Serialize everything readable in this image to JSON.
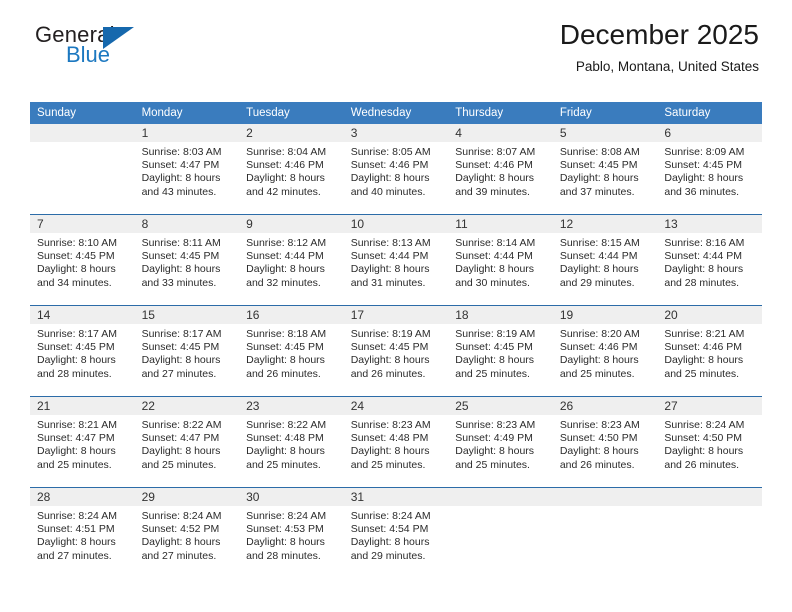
{
  "brand": {
    "name_part1": "General",
    "name_part2": "Blue",
    "flag_icon": "flag-triangle-icon",
    "accent_color": "#1668ad"
  },
  "header": {
    "title": "December 2025",
    "subtitle": "Pablo, Montana, United States"
  },
  "theme": {
    "header_bg": "#3a7cbe",
    "daynum_bg": "#efefef",
    "row_divider": "#2c6ca8"
  },
  "weekdays": [
    "Sunday",
    "Monday",
    "Tuesday",
    "Wednesday",
    "Thursday",
    "Friday",
    "Saturday"
  ],
  "weeks": [
    [
      {
        "day": ""
      },
      {
        "day": "1",
        "sunrise": "Sunrise: 8:03 AM",
        "sunset": "Sunset: 4:47 PM",
        "daylight_line1": "Daylight: 8 hours",
        "daylight_line2": "and 43 minutes."
      },
      {
        "day": "2",
        "sunrise": "Sunrise: 8:04 AM",
        "sunset": "Sunset: 4:46 PM",
        "daylight_line1": "Daylight: 8 hours",
        "daylight_line2": "and 42 minutes."
      },
      {
        "day": "3",
        "sunrise": "Sunrise: 8:05 AM",
        "sunset": "Sunset: 4:46 PM",
        "daylight_line1": "Daylight: 8 hours",
        "daylight_line2": "and 40 minutes."
      },
      {
        "day": "4",
        "sunrise": "Sunrise: 8:07 AM",
        "sunset": "Sunset: 4:46 PM",
        "daylight_line1": "Daylight: 8 hours",
        "daylight_line2": "and 39 minutes."
      },
      {
        "day": "5",
        "sunrise": "Sunrise: 8:08 AM",
        "sunset": "Sunset: 4:45 PM",
        "daylight_line1": "Daylight: 8 hours",
        "daylight_line2": "and 37 minutes."
      },
      {
        "day": "6",
        "sunrise": "Sunrise: 8:09 AM",
        "sunset": "Sunset: 4:45 PM",
        "daylight_line1": "Daylight: 8 hours",
        "daylight_line2": "and 36 minutes."
      }
    ],
    [
      {
        "day": "7",
        "sunrise": "Sunrise: 8:10 AM",
        "sunset": "Sunset: 4:45 PM",
        "daylight_line1": "Daylight: 8 hours",
        "daylight_line2": "and 34 minutes."
      },
      {
        "day": "8",
        "sunrise": "Sunrise: 8:11 AM",
        "sunset": "Sunset: 4:45 PM",
        "daylight_line1": "Daylight: 8 hours",
        "daylight_line2": "and 33 minutes."
      },
      {
        "day": "9",
        "sunrise": "Sunrise: 8:12 AM",
        "sunset": "Sunset: 4:44 PM",
        "daylight_line1": "Daylight: 8 hours",
        "daylight_line2": "and 32 minutes."
      },
      {
        "day": "10",
        "sunrise": "Sunrise: 8:13 AM",
        "sunset": "Sunset: 4:44 PM",
        "daylight_line1": "Daylight: 8 hours",
        "daylight_line2": "and 31 minutes."
      },
      {
        "day": "11",
        "sunrise": "Sunrise: 8:14 AM",
        "sunset": "Sunset: 4:44 PM",
        "daylight_line1": "Daylight: 8 hours",
        "daylight_line2": "and 30 minutes."
      },
      {
        "day": "12",
        "sunrise": "Sunrise: 8:15 AM",
        "sunset": "Sunset: 4:44 PM",
        "daylight_line1": "Daylight: 8 hours",
        "daylight_line2": "and 29 minutes."
      },
      {
        "day": "13",
        "sunrise": "Sunrise: 8:16 AM",
        "sunset": "Sunset: 4:44 PM",
        "daylight_line1": "Daylight: 8 hours",
        "daylight_line2": "and 28 minutes."
      }
    ],
    [
      {
        "day": "14",
        "sunrise": "Sunrise: 8:17 AM",
        "sunset": "Sunset: 4:45 PM",
        "daylight_line1": "Daylight: 8 hours",
        "daylight_line2": "and 28 minutes."
      },
      {
        "day": "15",
        "sunrise": "Sunrise: 8:17 AM",
        "sunset": "Sunset: 4:45 PM",
        "daylight_line1": "Daylight: 8 hours",
        "daylight_line2": "and 27 minutes."
      },
      {
        "day": "16",
        "sunrise": "Sunrise: 8:18 AM",
        "sunset": "Sunset: 4:45 PM",
        "daylight_line1": "Daylight: 8 hours",
        "daylight_line2": "and 26 minutes."
      },
      {
        "day": "17",
        "sunrise": "Sunrise: 8:19 AM",
        "sunset": "Sunset: 4:45 PM",
        "daylight_line1": "Daylight: 8 hours",
        "daylight_line2": "and 26 minutes."
      },
      {
        "day": "18",
        "sunrise": "Sunrise: 8:19 AM",
        "sunset": "Sunset: 4:45 PM",
        "daylight_line1": "Daylight: 8 hours",
        "daylight_line2": "and 25 minutes."
      },
      {
        "day": "19",
        "sunrise": "Sunrise: 8:20 AM",
        "sunset": "Sunset: 4:46 PM",
        "daylight_line1": "Daylight: 8 hours",
        "daylight_line2": "and 25 minutes."
      },
      {
        "day": "20",
        "sunrise": "Sunrise: 8:21 AM",
        "sunset": "Sunset: 4:46 PM",
        "daylight_line1": "Daylight: 8 hours",
        "daylight_line2": "and 25 minutes."
      }
    ],
    [
      {
        "day": "21",
        "sunrise": "Sunrise: 8:21 AM",
        "sunset": "Sunset: 4:47 PM",
        "daylight_line1": "Daylight: 8 hours",
        "daylight_line2": "and 25 minutes."
      },
      {
        "day": "22",
        "sunrise": "Sunrise: 8:22 AM",
        "sunset": "Sunset: 4:47 PM",
        "daylight_line1": "Daylight: 8 hours",
        "daylight_line2": "and 25 minutes."
      },
      {
        "day": "23",
        "sunrise": "Sunrise: 8:22 AM",
        "sunset": "Sunset: 4:48 PM",
        "daylight_line1": "Daylight: 8 hours",
        "daylight_line2": "and 25 minutes."
      },
      {
        "day": "24",
        "sunrise": "Sunrise: 8:23 AM",
        "sunset": "Sunset: 4:48 PM",
        "daylight_line1": "Daylight: 8 hours",
        "daylight_line2": "and 25 minutes."
      },
      {
        "day": "25",
        "sunrise": "Sunrise: 8:23 AM",
        "sunset": "Sunset: 4:49 PM",
        "daylight_line1": "Daylight: 8 hours",
        "daylight_line2": "and 25 minutes."
      },
      {
        "day": "26",
        "sunrise": "Sunrise: 8:23 AM",
        "sunset": "Sunset: 4:50 PM",
        "daylight_line1": "Daylight: 8 hours",
        "daylight_line2": "and 26 minutes."
      },
      {
        "day": "27",
        "sunrise": "Sunrise: 8:24 AM",
        "sunset": "Sunset: 4:50 PM",
        "daylight_line1": "Daylight: 8 hours",
        "daylight_line2": "and 26 minutes."
      }
    ],
    [
      {
        "day": "28",
        "sunrise": "Sunrise: 8:24 AM",
        "sunset": "Sunset: 4:51 PM",
        "daylight_line1": "Daylight: 8 hours",
        "daylight_line2": "and 27 minutes."
      },
      {
        "day": "29",
        "sunrise": "Sunrise: 8:24 AM",
        "sunset": "Sunset: 4:52 PM",
        "daylight_line1": "Daylight: 8 hours",
        "daylight_line2": "and 27 minutes."
      },
      {
        "day": "30",
        "sunrise": "Sunrise: 8:24 AM",
        "sunset": "Sunset: 4:53 PM",
        "daylight_line1": "Daylight: 8 hours",
        "daylight_line2": "and 28 minutes."
      },
      {
        "day": "31",
        "sunrise": "Sunrise: 8:24 AM",
        "sunset": "Sunset: 4:54 PM",
        "daylight_line1": "Daylight: 8 hours",
        "daylight_line2": "and 29 minutes."
      },
      {
        "day": ""
      },
      {
        "day": ""
      },
      {
        "day": ""
      }
    ]
  ]
}
